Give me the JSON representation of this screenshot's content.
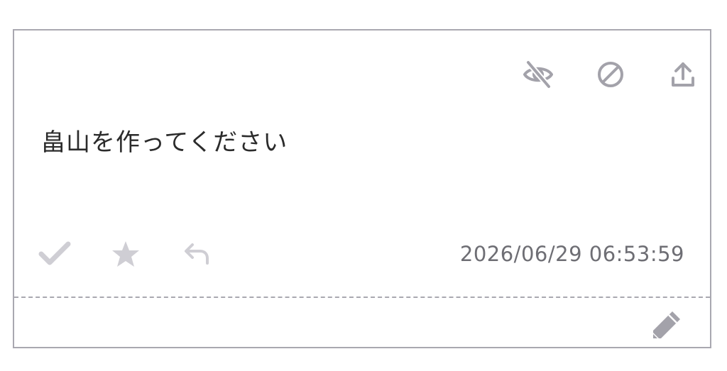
{
  "message": {
    "text": "畠山を作ってください"
  },
  "meta": {
    "timestamp": "2026/06/29 06:53:59"
  },
  "icons": {
    "hide": "eye-off-icon",
    "block": "block-icon",
    "share": "upload-icon",
    "check": "check-icon",
    "star": "star-icon",
    "reply": "reply-icon",
    "edit": "pencil-icon"
  },
  "colors": {
    "icon_dark": "#a3a2aa",
    "icon_light": "#cfced4",
    "border": "#a9a8b0",
    "text": "#2b2b2b",
    "timestamp": "#6e6e74"
  }
}
